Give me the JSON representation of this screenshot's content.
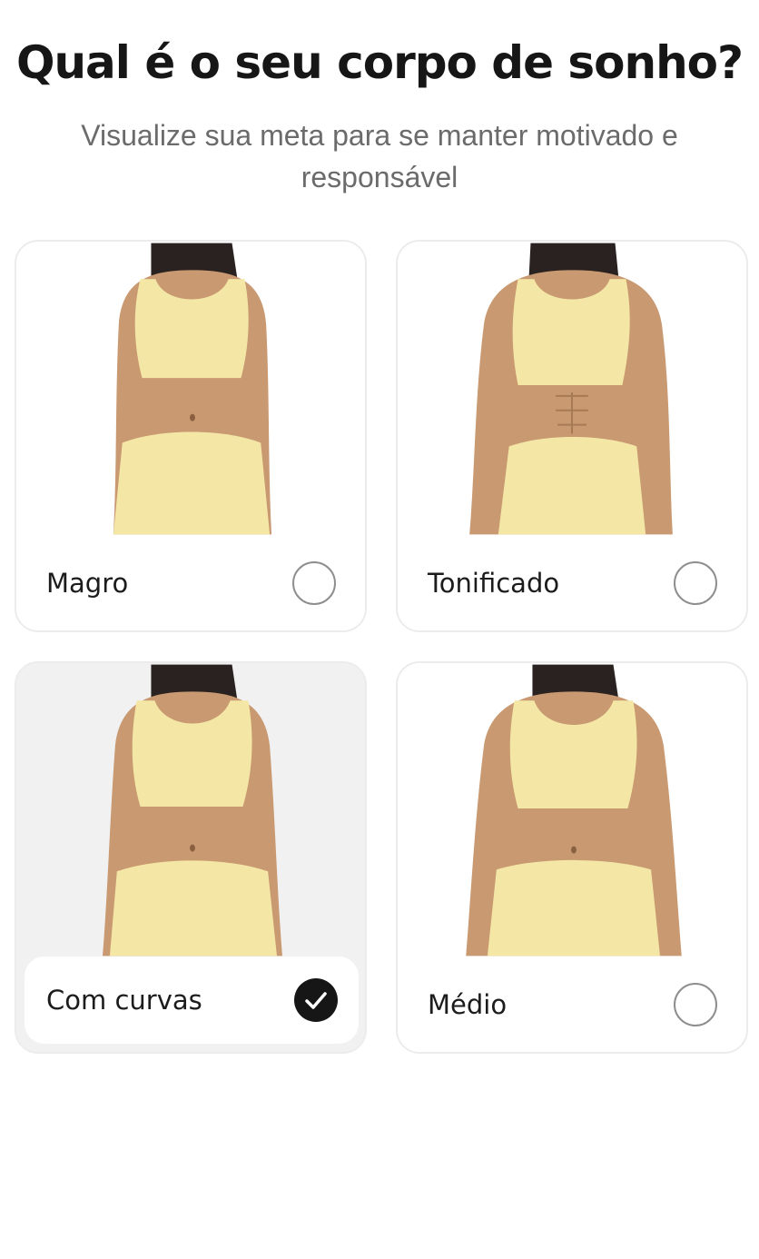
{
  "header": {
    "title": "Qual é o seu corpo de sonho?",
    "subtitle": "Visualize sua meta para se manter motivado e responsável"
  },
  "options": [
    {
      "label": "Magro",
      "selected": false,
      "icon": "radio-unchecked"
    },
    {
      "label": "Tonificado",
      "selected": false,
      "icon": "radio-unchecked"
    },
    {
      "label": "Com curvas",
      "selected": true,
      "icon": "checkmark-icon"
    },
    {
      "label": "Médio",
      "selected": false,
      "icon": "radio-unchecked"
    }
  ],
  "colors": {
    "outfit": "#f4e7a6",
    "skin": "#c99a72",
    "hair": "#2a2220",
    "check_fill": "#161616",
    "selected_card_bg": "#f1f1f1"
  }
}
